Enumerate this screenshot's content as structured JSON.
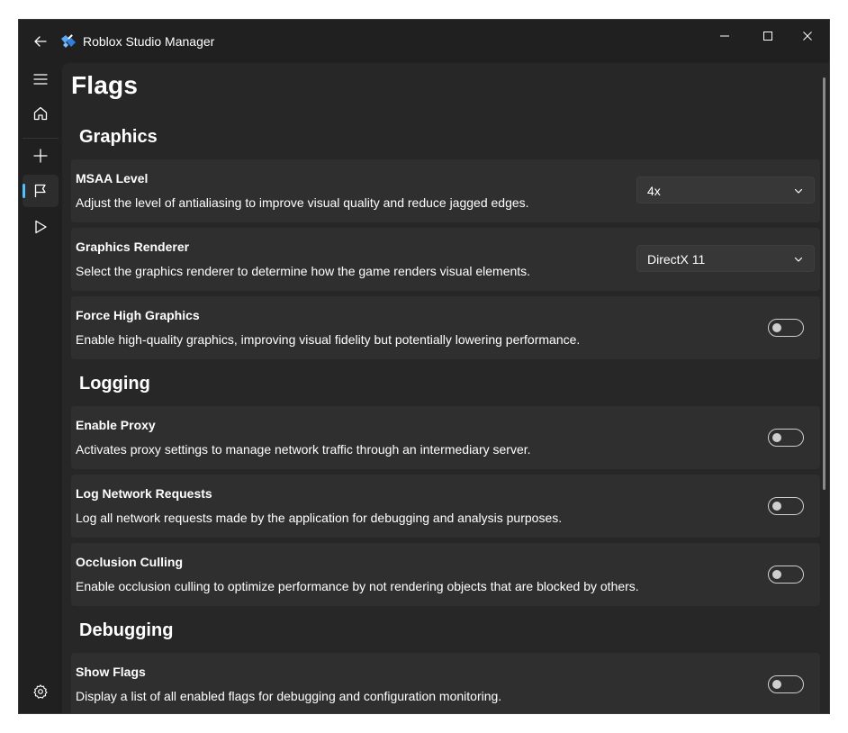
{
  "window": {
    "title": "Roblox Studio Manager",
    "accent_color": "#4cc2ff",
    "background_color": "#202020"
  },
  "sidebar": {
    "items": [
      {
        "name": "menu",
        "icon": "hamburger-icon"
      },
      {
        "name": "home",
        "icon": "home-icon"
      },
      {
        "name": "add",
        "icon": "plus-icon"
      },
      {
        "name": "flags",
        "icon": "flag-icon",
        "selected": true
      },
      {
        "name": "play",
        "icon": "play-icon"
      },
      {
        "name": "settings",
        "icon": "gear-icon"
      }
    ]
  },
  "page": {
    "title": "Flags"
  },
  "sections": {
    "graphics": {
      "title": "Graphics",
      "msaa": {
        "title": "MSAA Level",
        "description": "Adjust the level of antialiasing to improve visual quality and reduce jagged edges.",
        "value": "4x"
      },
      "renderer": {
        "title": "Graphics Renderer",
        "description": "Select the graphics renderer to determine how the game renders visual elements.",
        "value": "DirectX 11"
      },
      "force_high": {
        "title": "Force High Graphics",
        "description": "Enable high-quality graphics, improving visual fidelity but potentially lowering performance.",
        "enabled": false
      }
    },
    "logging": {
      "title": "Logging",
      "proxy": {
        "title": "Enable Proxy",
        "description": "Activates proxy settings to manage network traffic through an intermediary server.",
        "enabled": false
      },
      "network": {
        "title": "Log Network Requests",
        "description": "Log all network requests made by the application for debugging and analysis purposes.",
        "enabled": false
      },
      "occlusion": {
        "title": "Occlusion Culling",
        "description": "Enable occlusion culling to optimize performance by not rendering objects that are blocked by others.",
        "enabled": false
      }
    },
    "debugging": {
      "title": "Debugging",
      "show_flags": {
        "title": "Show Flags",
        "description": "Display a list of all enabled flags for debugging and configuration monitoring.",
        "enabled": false
      }
    }
  }
}
